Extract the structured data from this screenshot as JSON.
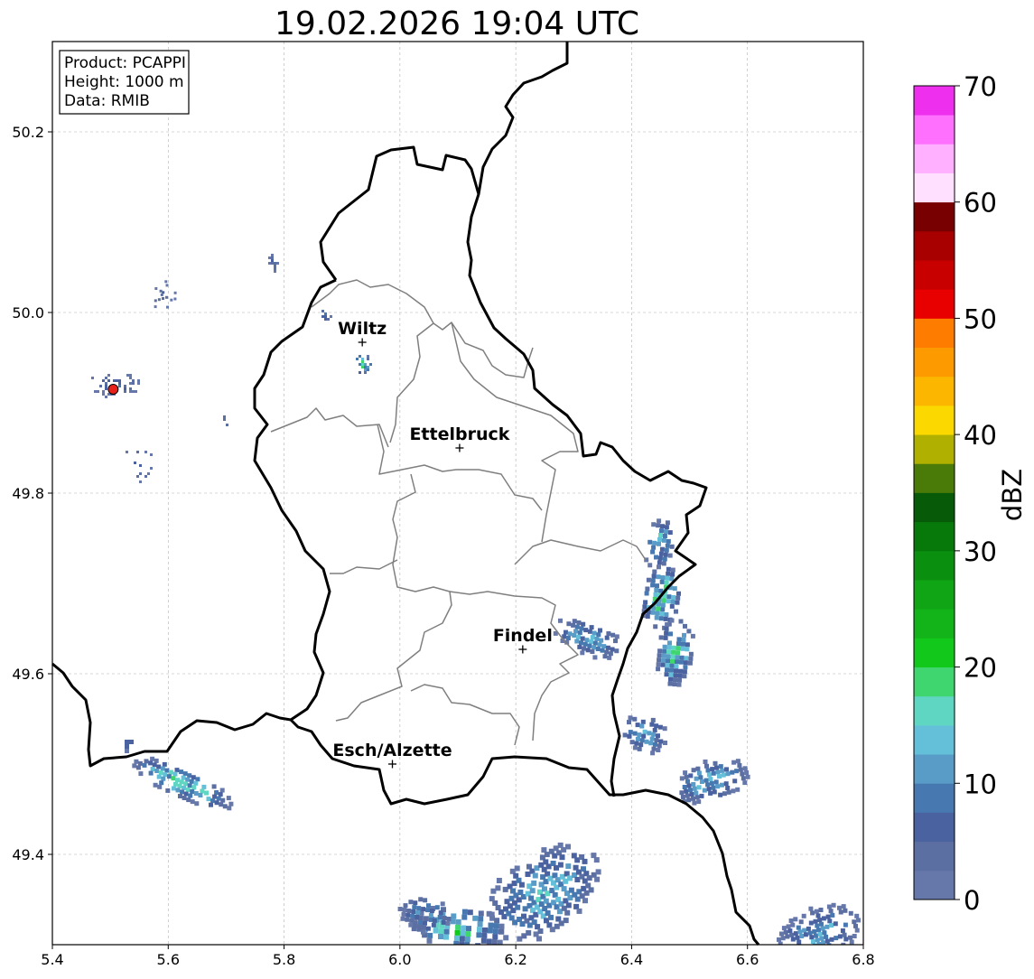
{
  "title": "19.02.2026 19:04 UTC",
  "info_box": {
    "product": "Product: PCAPPI",
    "height": "Height: 1000 m",
    "data": "Data: RMIB"
  },
  "x_ticks": [
    "5.4",
    "5.6",
    "5.8",
    "6.0",
    "6.2",
    "6.4",
    "6.6",
    "6.8"
  ],
  "y_ticks": [
    "49.4",
    "49.6",
    "49.8",
    "50.0",
    "50.2"
  ],
  "cities": [
    {
      "name": "Wiltz",
      "lon": 5.935,
      "lat": 49.967
    },
    {
      "name": "Ettelbruck",
      "lon": 6.103,
      "lat": 49.85
    },
    {
      "name": "Findel",
      "lon": 6.212,
      "lat": 49.627
    },
    {
      "name": "Esch/Alzette",
      "lon": 5.987,
      "lat": 49.5
    }
  ],
  "radar_site": {
    "lon": 5.505,
    "lat": 49.915,
    "color": "#e8201a"
  },
  "colorbar": {
    "label": "dBZ",
    "ticks": [
      "0",
      "10",
      "20",
      "30",
      "40",
      "50",
      "60",
      "70"
    ],
    "colors": [
      "#6677aa",
      "#5b6fa3",
      "#4a62a0",
      "#4878b0",
      "#5a9cc8",
      "#64c0d8",
      "#5fd6c2",
      "#3fd670",
      "#12c81a",
      "#12b41a",
      "#0fa514",
      "#0a8f0f",
      "#07780a",
      "#065a08",
      "#4a7a08",
      "#b0b000",
      "#fad800",
      "#fcb600",
      "#fd9a00",
      "#fe7c00",
      "#e80000",
      "#c80000",
      "#a80000",
      "#780000",
      "#ffe0ff",
      "#ffb0ff",
      "#ff70ff",
      "#ee30ee"
    ]
  },
  "colors": {
    "border": "#000000",
    "canton": "#7f7f7f",
    "grid": "#b0b0b0"
  }
}
